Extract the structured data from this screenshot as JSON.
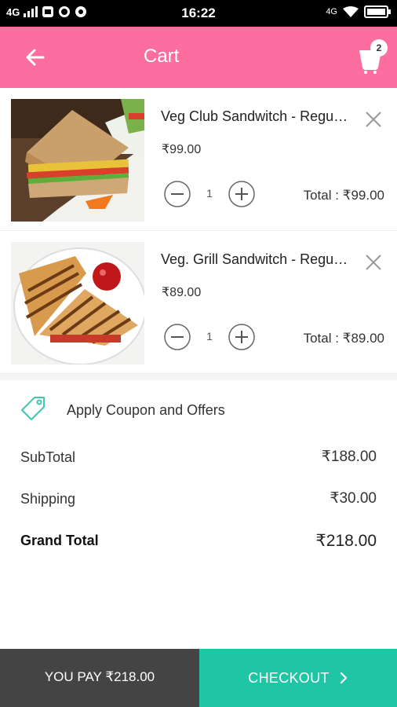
{
  "status_bar": {
    "network": "4G",
    "time": "16:22",
    "right_network": "4G",
    "icons": [
      "signal-icon",
      "gallery-icon",
      "whatsapp-icon",
      "chrome-icon",
      "volte-icon",
      "wifi-icon",
      "battery-icon"
    ]
  },
  "app_bar": {
    "title": "Cart",
    "cart_count": "2",
    "color": "#fb6e9f"
  },
  "cart_items": [
    {
      "name": "Veg Club Sandwitch - Regular",
      "price": "₹99.00",
      "quantity": "1",
      "total": "Total : ₹99.00"
    },
    {
      "name": "Veg. Grill Sandwitch - Regular",
      "price": "₹89.00",
      "quantity": "1",
      "total": "Total : ₹89.00"
    }
  ],
  "coupon": {
    "label": "Apply Coupon and Offers",
    "icon": "tag-icon"
  },
  "summary": {
    "subtotal_label": "SubTotal",
    "subtotal_value": "₹188.00",
    "shipping_label": "Shipping",
    "shipping_value": "₹30.00",
    "grand_label": "Grand Total",
    "grand_value": "₹218.00"
  },
  "bottom_bar": {
    "you_pay": "YOU PAY ₹218.00",
    "checkout": "CHECKOUT",
    "checkout_color": "#20c5a5",
    "you_pay_color": "#444444"
  }
}
